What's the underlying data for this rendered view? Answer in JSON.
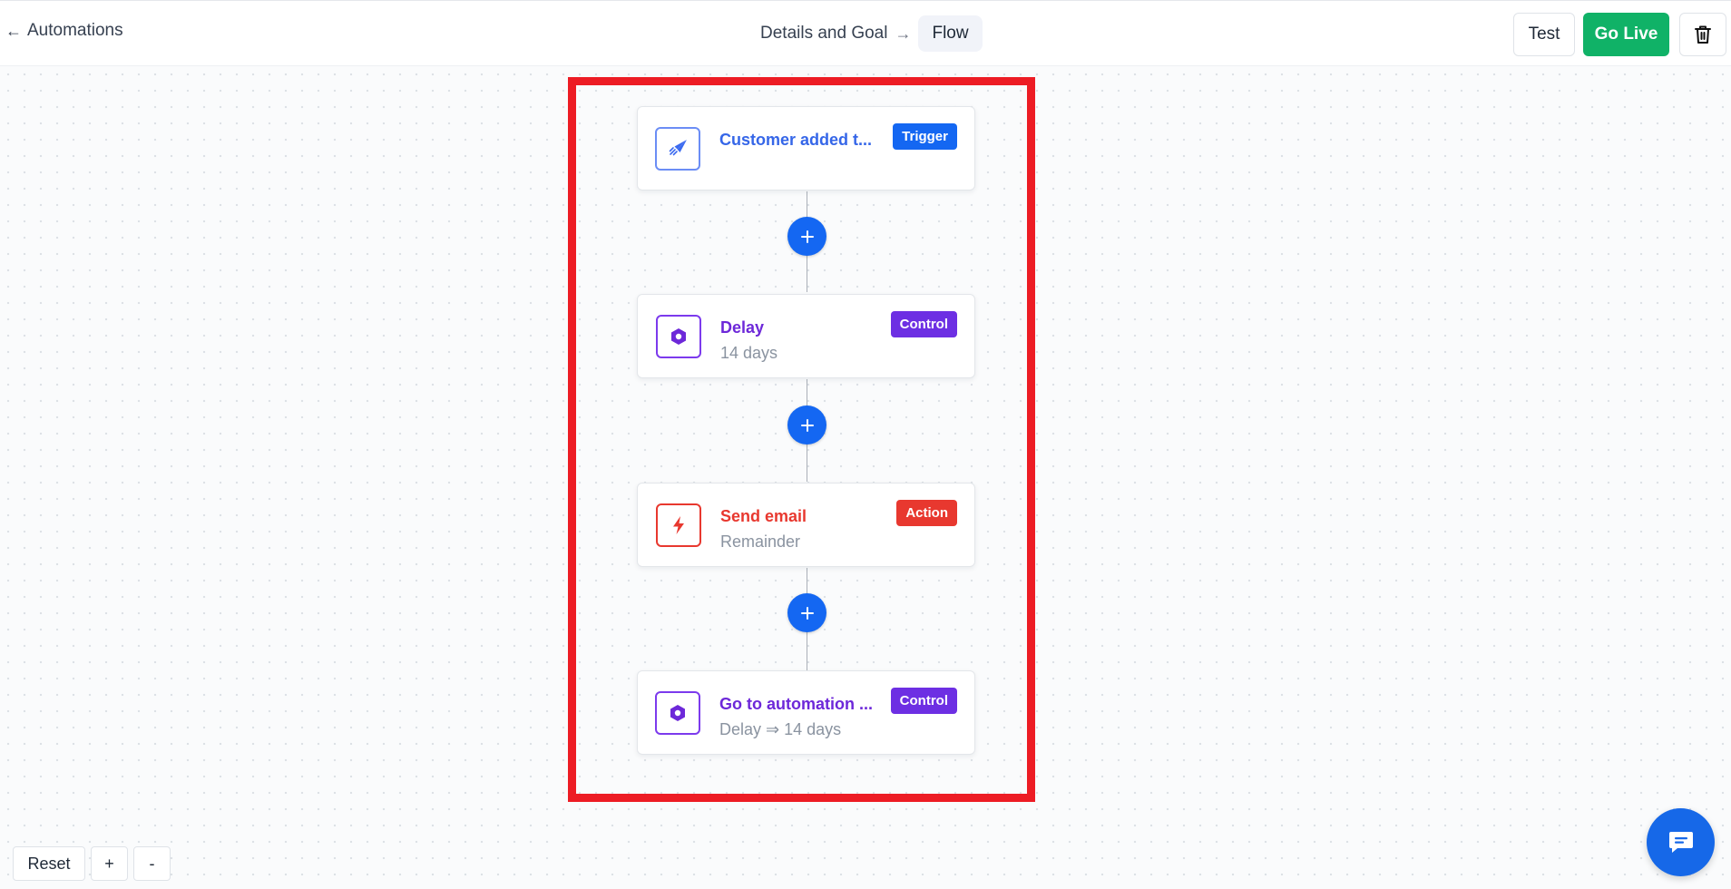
{
  "header": {
    "back_label": "Automations",
    "steps": [
      {
        "label": "Details and Goal",
        "active": false
      },
      {
        "label": "Flow",
        "active": true
      }
    ],
    "test_label": "Test",
    "go_live_label": "Go Live"
  },
  "flow": {
    "nodes": [
      {
        "title": "Customer added t...",
        "subtitle": "",
        "badge": "Trigger",
        "kind": "trigger",
        "icon": "paper-plane-icon"
      },
      {
        "title": "Delay",
        "subtitle": "14 days",
        "badge": "Control",
        "kind": "control",
        "icon": "hexagon-icon"
      },
      {
        "title": "Send email",
        "subtitle": "Remainder",
        "badge": "Action",
        "kind": "action",
        "icon": "lightning-icon"
      },
      {
        "title": "Go to automation ...",
        "subtitle": "Delay ⇒ 14 days",
        "badge": "Control",
        "kind": "control",
        "icon": "hexagon-icon"
      }
    ]
  },
  "zoom_controls": {
    "reset_label": "Reset",
    "zoom_in_label": "+",
    "zoom_out_label": "-"
  },
  "colors": {
    "trigger": "#1467f2",
    "control": "#7c3aed",
    "action": "#e8382f",
    "go_live": "#10b267",
    "highlight": "#ed1c24"
  }
}
